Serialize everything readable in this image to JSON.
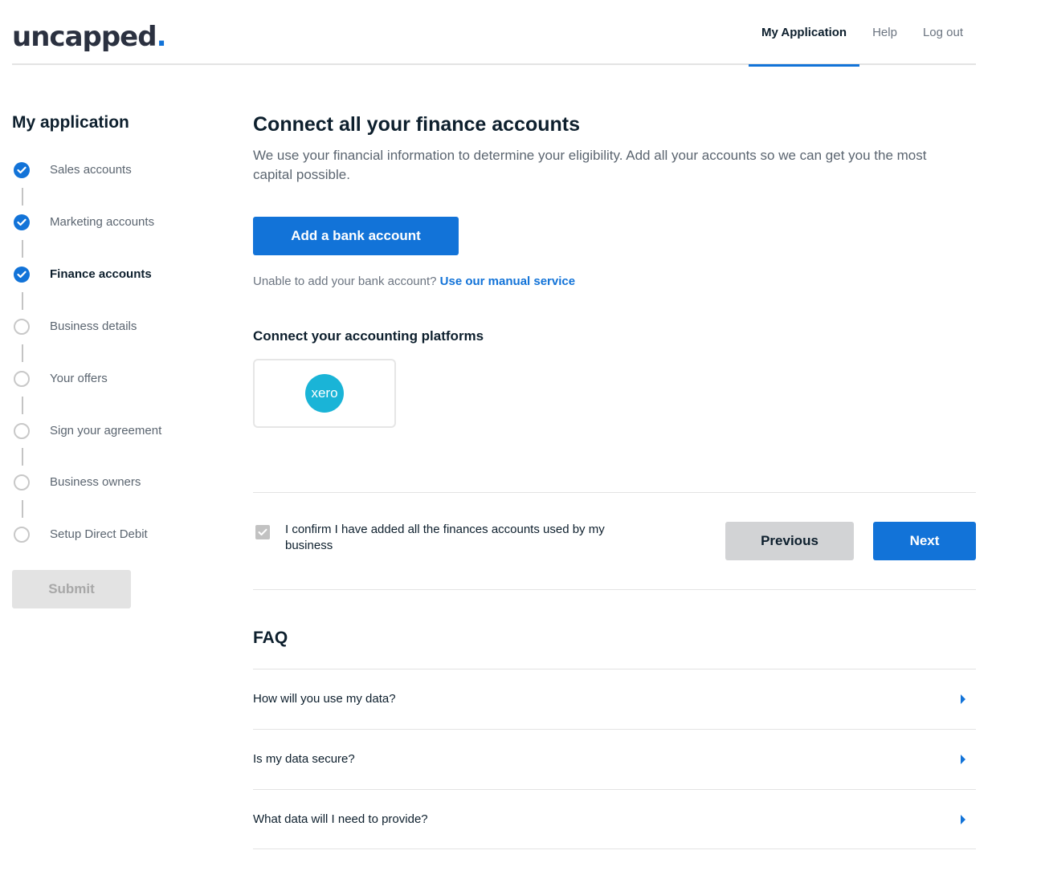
{
  "header": {
    "logo_text": "uncapped",
    "logo_dot": ".",
    "nav": [
      {
        "label": "My Application",
        "active": true
      },
      {
        "label": "Help",
        "active": false
      },
      {
        "label": "Log out",
        "active": false
      }
    ]
  },
  "sidebar": {
    "title": "My application",
    "steps": [
      {
        "label": "Sales accounts",
        "status": "done"
      },
      {
        "label": "Marketing accounts",
        "status": "done"
      },
      {
        "label": "Finance accounts",
        "status": "current"
      },
      {
        "label": "Business details",
        "status": "todo"
      },
      {
        "label": "Your offers",
        "status": "todo"
      },
      {
        "label": "Sign your agreement",
        "status": "todo"
      },
      {
        "label": "Business owners",
        "status": "todo"
      },
      {
        "label": "Setup Direct Debit",
        "status": "todo"
      }
    ],
    "submit_label": "Submit"
  },
  "main": {
    "title": "Connect all your finance accounts",
    "intro": "We use your financial information to determine your eligibility. Add all your accounts so we can get you the most capital possible.",
    "add_bank_label": "Add a bank account",
    "manual_prompt": "Unable to add your bank account?",
    "manual_link": "Use our manual service",
    "accounting_title": "Connect your accounting platforms",
    "platforms": [
      {
        "name": "xero",
        "logo_text": "xero"
      }
    ],
    "confirm_text": "I confirm I have added all the finances accounts used by my business",
    "confirm_checked": true,
    "previous_label": "Previous",
    "next_label": "Next"
  },
  "faq": {
    "title": "FAQ",
    "items": [
      {
        "question": "How will you use my data?"
      },
      {
        "question": "Is my data secure?"
      },
      {
        "question": "What data will I need to provide?"
      }
    ]
  },
  "colors": {
    "brand_blue": "#1273d8",
    "xero_teal": "#1ab4d7",
    "text_dark": "#0d1f2d",
    "text_muted": "#5b6570"
  }
}
